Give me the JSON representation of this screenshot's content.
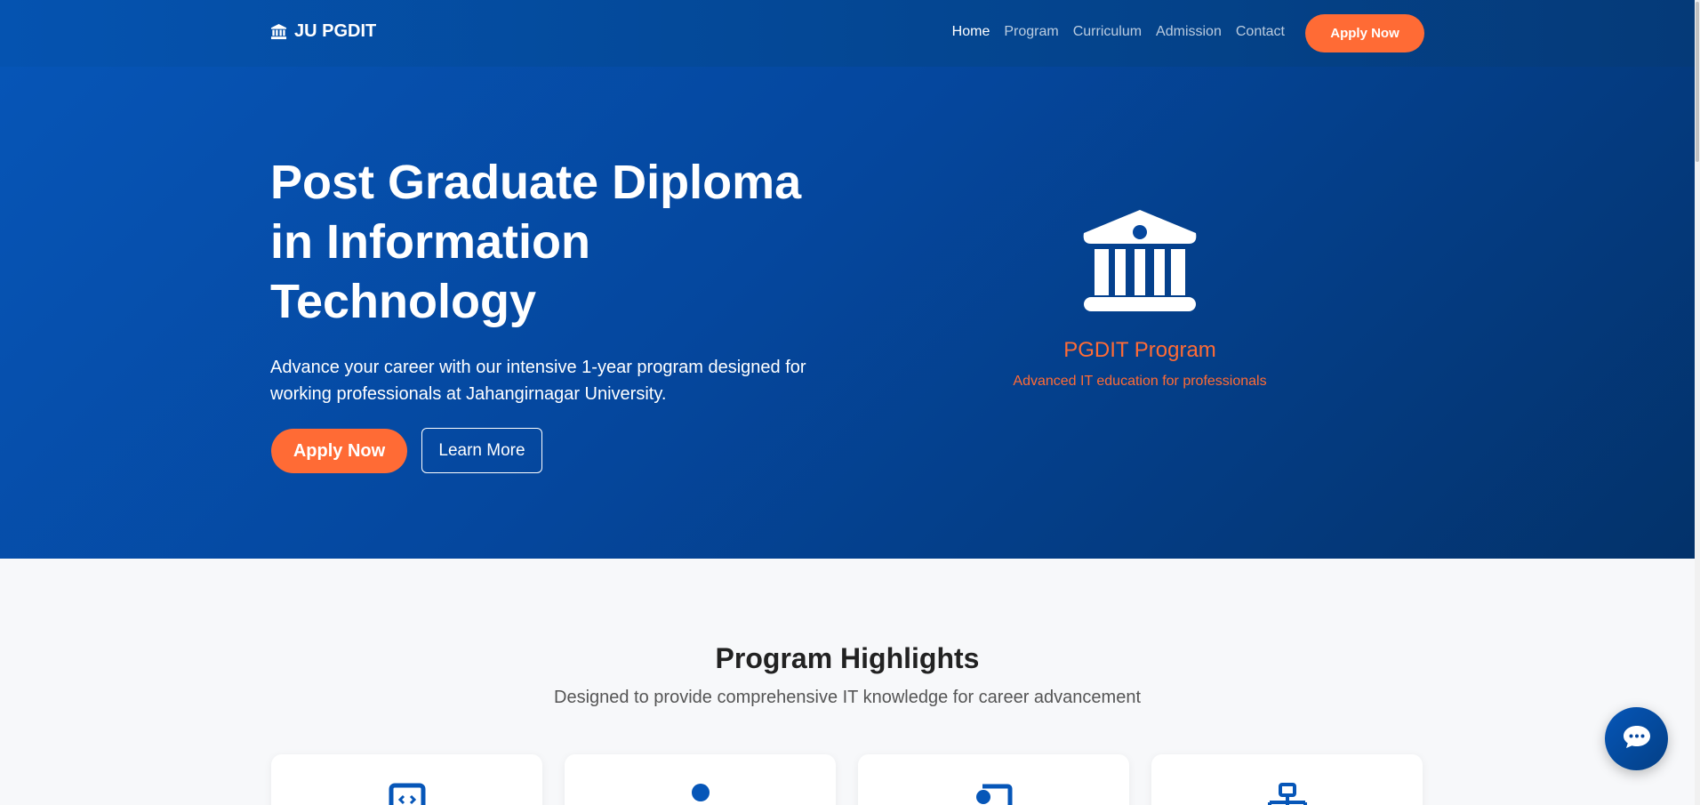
{
  "brand": {
    "icon": "university-icon",
    "name": "JU PGDIT"
  },
  "nav": {
    "links": [
      "Home",
      "Program",
      "Curriculum",
      "Admission",
      "Contact"
    ],
    "active": "Home",
    "apply_label": "Apply Now"
  },
  "hero": {
    "title": "Post Graduate Diploma in Information Technology",
    "subtitle": "Advance your career with our intensive 1-year program designed for working professionals at Jahangirnagar University.",
    "apply_label": "Apply Now",
    "learn_label": "Learn More",
    "card": {
      "icon": "university-icon",
      "title": "PGDIT Program",
      "subtitle": "Advanced IT education for professionals"
    }
  },
  "highlights": {
    "title": "Program Highlights",
    "subtitle": "Designed to provide comprehensive IT knowledge for career advancement",
    "cards": [
      {
        "icon": "code-icon"
      },
      {
        "icon": "user-icon"
      },
      {
        "icon": "certificate-icon"
      },
      {
        "icon": "network-icon"
      }
    ]
  },
  "chat": {
    "icon": "chat-icon"
  },
  "colors": {
    "primary": "#0656b8",
    "primary_dark": "#03326a",
    "accent": "#ff6b35",
    "background": "#f7f8fa"
  }
}
